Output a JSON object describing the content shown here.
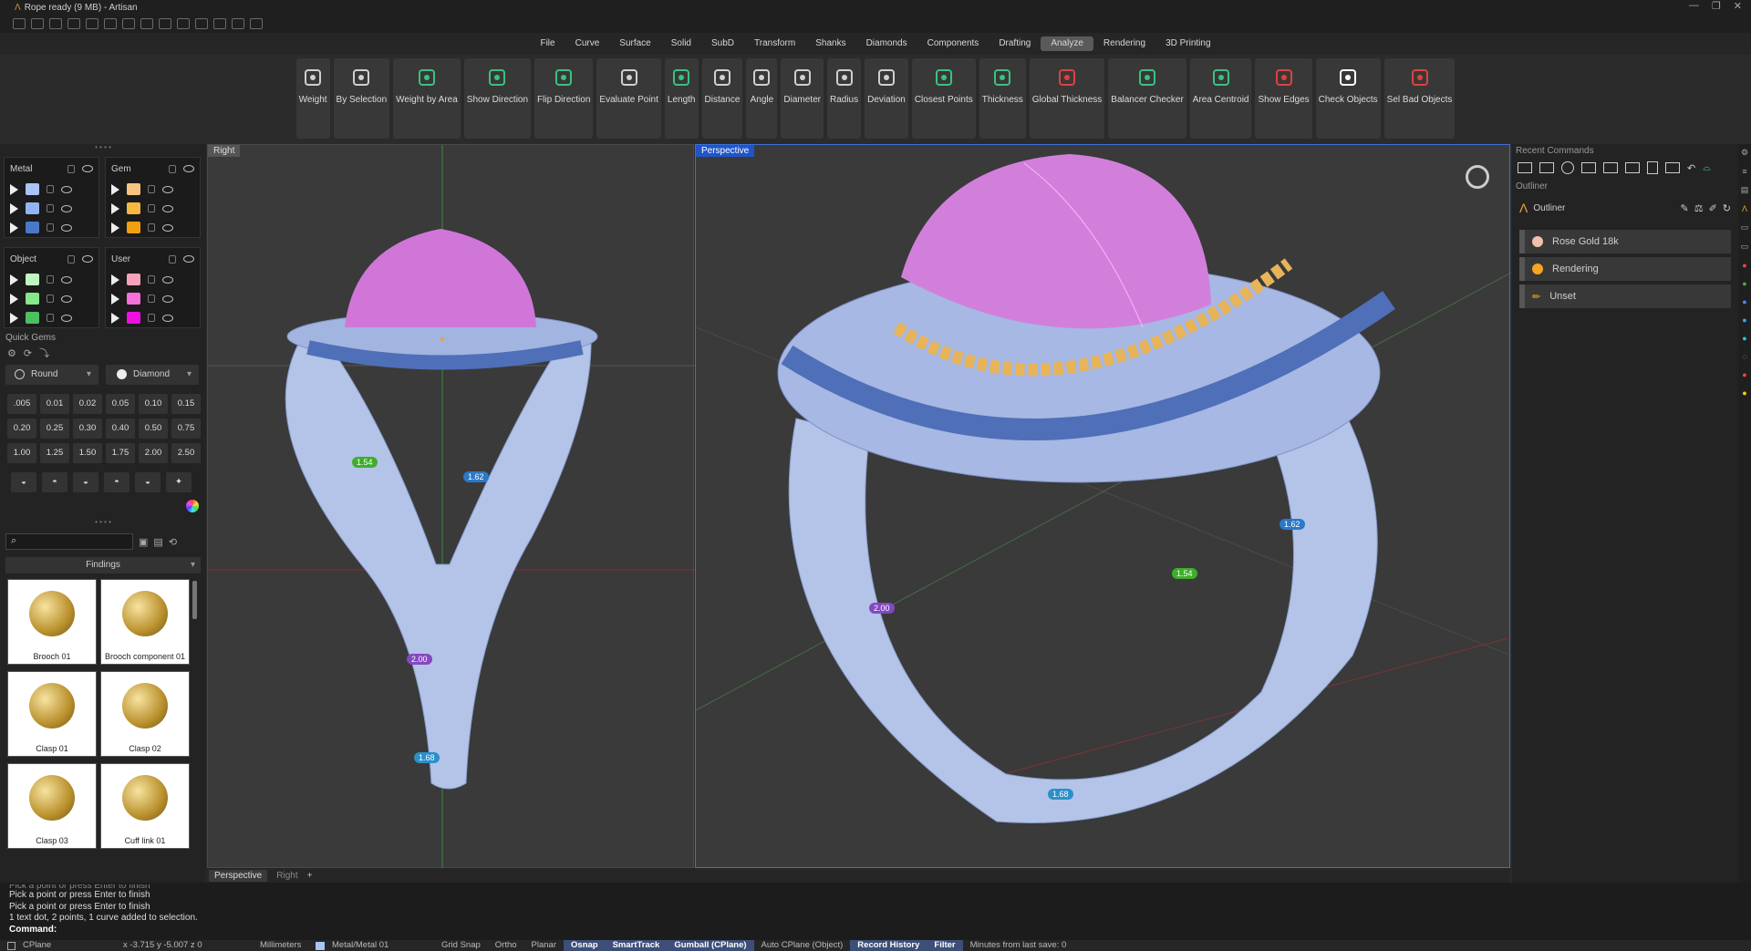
{
  "window": {
    "title": "Rope ready (9 MB) - Artisan"
  },
  "menu": [
    "File",
    "Curve",
    "Surface",
    "Solid",
    "SubD",
    "Transform",
    "Shanks",
    "Diamonds",
    "Components",
    "Drafting",
    "Analyze",
    "Rendering",
    "3D Printing"
  ],
  "menu_active": "Analyze",
  "tools": [
    {
      "label": "Weight",
      "icon": "scale-icon"
    },
    {
      "label": "By Selection",
      "icon": "select-icon"
    },
    {
      "label": "Weight by Area",
      "icon": "area-weight-icon"
    },
    {
      "label": "Show Direction",
      "icon": "direction-icon"
    },
    {
      "label": "Flip Direction",
      "icon": "flip-icon"
    },
    {
      "label": "Evaluate Point",
      "icon": "point-xyz-icon"
    },
    {
      "label": "Length",
      "icon": "length-icon"
    },
    {
      "label": "Distance",
      "icon": "distance-icon"
    },
    {
      "label": "Angle",
      "icon": "angle-icon"
    },
    {
      "label": "Diameter",
      "icon": "diameter-icon"
    },
    {
      "label": "Radius",
      "icon": "radius-icon"
    },
    {
      "label": "Deviation",
      "icon": "deviation-icon"
    },
    {
      "label": "Closest Points",
      "icon": "closest-points-icon"
    },
    {
      "label": "Thickness",
      "icon": "thickness-icon"
    },
    {
      "label": "Global Thickness",
      "icon": "global-thickness-icon"
    },
    {
      "label": "Balancer Checker",
      "icon": "balancer-icon"
    },
    {
      "label": "Area Centroid",
      "icon": "centroid-icon"
    },
    {
      "label": "Show Edges",
      "icon": "edges-icon"
    },
    {
      "label": "Check Objects",
      "icon": "check-icon"
    },
    {
      "label": "Sel Bad Objects",
      "icon": "bad-objects-icon"
    }
  ],
  "layers": {
    "groups": [
      {
        "name": "Metal",
        "colors": [
          "#a9c4f5",
          "#92b4f0",
          "#4a78c8"
        ]
      },
      {
        "name": "Gem",
        "colors": [
          "#f5c580",
          "#f5b840",
          "#f0a010"
        ]
      },
      {
        "name": "Object",
        "colors": [
          "#bff5c0",
          "#86e88a",
          "#4cc060"
        ]
      },
      {
        "name": "User",
        "colors": [
          "#f5a3b8",
          "#f570d8",
          "#ee10e0"
        ]
      }
    ]
  },
  "quick_gems": {
    "title": "Quick Gems",
    "shape": "Round",
    "material": "Diamond",
    "sizes": [
      ".005",
      "0.01",
      "0.02",
      "0.05",
      "0.10",
      "0.15",
      "0.20",
      "0.25",
      "0.30",
      "0.40",
      "0.50",
      "0.75",
      "1.00",
      "1.25",
      "1.50",
      "1.75",
      "2.00",
      "2.50"
    ]
  },
  "library": {
    "category": "Findings",
    "items": [
      "Brooch 01",
      "Brooch component 01",
      "Clasp 01",
      "Clasp 02",
      "Clasp 03",
      "Cuff link 01"
    ]
  },
  "viewports": {
    "left_label": "Right",
    "right_label": "Perspective",
    "tabs": [
      "Perspective",
      "Right"
    ],
    "left_dims": [
      "1.54",
      "1.62",
      "2.00",
      "1.68"
    ],
    "right_dims": [
      "1.62",
      "1.54",
      "2.00",
      "1.68"
    ]
  },
  "right_panel": {
    "recent": "Recent Commands",
    "outliner_section": "Outliner",
    "outliner_title": "Outliner",
    "rows": [
      "Rose Gold 18k",
      "Rendering",
      "Unset"
    ]
  },
  "command": {
    "history": [
      "Pick a point or press Enter to finish",
      "Pick a point or press Enter to finish",
      "Pick a point or press Enter to finish",
      "1 text dot, 2 points, 1 curve added to selection."
    ],
    "prompt": "Command:"
  },
  "status": {
    "cplane": "CPlane",
    "coords": "x -3.715  y -5.007  z 0",
    "units": "Millimeters",
    "layer": "Metal/Metal 01",
    "toggles": [
      {
        "label": "Grid Snap",
        "on": false
      },
      {
        "label": "Ortho",
        "on": false
      },
      {
        "label": "Planar",
        "on": false
      },
      {
        "label": "Osnap",
        "on": true
      },
      {
        "label": "SmartTrack",
        "on": true
      },
      {
        "label": "Gumball (CPlane)",
        "on": true
      },
      {
        "label": "Auto CPlane (Object)",
        "on": false
      },
      {
        "label": "Record History",
        "on": true
      },
      {
        "label": "Filter",
        "on": true
      }
    ],
    "save": "Minutes from last save: 0"
  }
}
